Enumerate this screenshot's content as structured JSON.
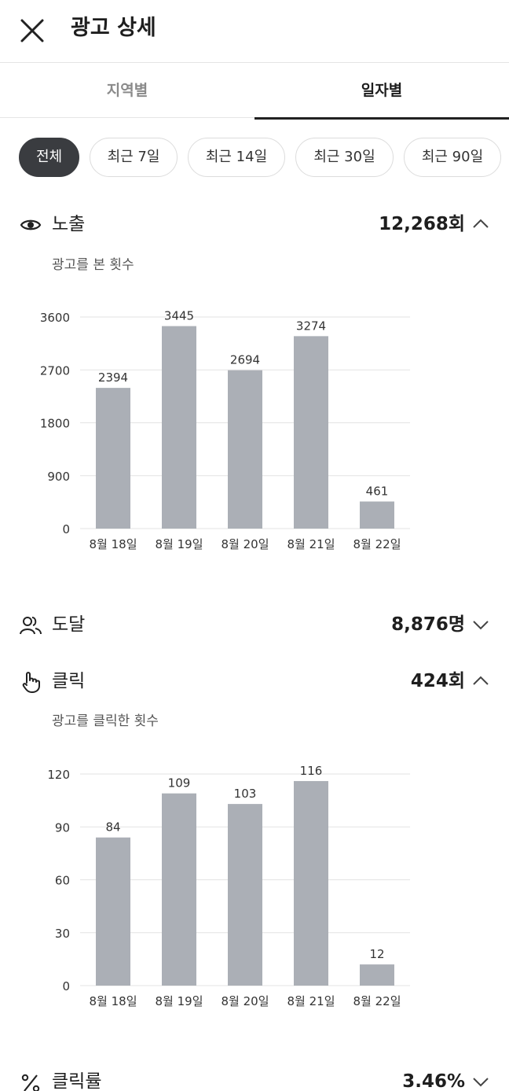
{
  "header": {
    "title": "광고 상세",
    "close_icon": "close-icon"
  },
  "tabs": [
    {
      "label": "지역별",
      "active": false
    },
    {
      "label": "일자별",
      "active": true
    }
  ],
  "filters": [
    {
      "label": "전체",
      "active": true
    },
    {
      "label": "최근 7일",
      "active": false
    },
    {
      "label": "최근 14일",
      "active": false
    },
    {
      "label": "최근 30일",
      "active": false
    },
    {
      "label": "최근 90일",
      "active": false
    }
  ],
  "colors": {
    "bar": "#abafb6",
    "active_chip": "#3a3c40",
    "grid": "#e3e3e3"
  },
  "metrics": {
    "impressions": {
      "icon": "eye-icon",
      "label": "노출",
      "value": "12,268회",
      "expanded": true,
      "description": "광고를 본 횟수"
    },
    "reach": {
      "icon": "people-icon",
      "label": "도달",
      "value": "8,876명",
      "expanded": false
    },
    "clicks": {
      "icon": "hand-pointer-icon",
      "label": "클릭",
      "value": "424회",
      "expanded": true,
      "description": "광고를 클릭한 횟수"
    },
    "ctr": {
      "icon": "percent-icon",
      "label": "클릭률",
      "value": "3.46%",
      "expanded": false
    }
  },
  "chart_data": [
    {
      "type": "bar",
      "categories": [
        "8월 18일",
        "8월 19일",
        "8월 20일",
        "8월 21일",
        "8월 22일"
      ],
      "values": [
        2394,
        3445,
        2694,
        3274,
        461
      ],
      "yticks": [
        0,
        900,
        1800,
        2700,
        3600
      ],
      "ylim": [
        0,
        3600
      ],
      "grid": true
    },
    {
      "type": "bar",
      "categories": [
        "8월 18일",
        "8월 19일",
        "8월 20일",
        "8월 21일",
        "8월 22일"
      ],
      "values": [
        84,
        109,
        103,
        116,
        12
      ],
      "yticks": [
        0,
        30,
        60,
        90,
        120
      ],
      "ylim": [
        0,
        120
      ],
      "grid": true
    }
  ]
}
